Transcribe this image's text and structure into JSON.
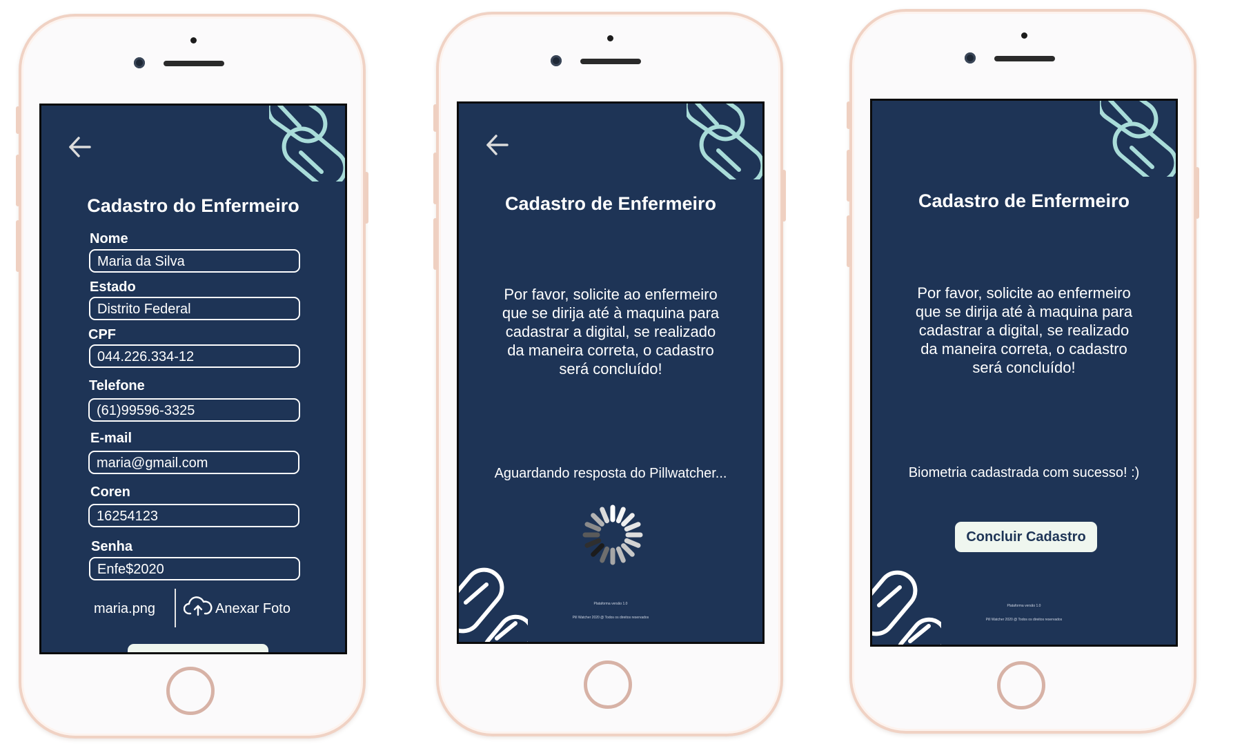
{
  "colors": {
    "screen_bg": "#1e3456",
    "accent_line": "#a9dcd9",
    "button_bg": "#eff6ef",
    "phone_frame": "#f0d2c4"
  },
  "phone1": {
    "back_icon": "arrow-left-icon",
    "title": "Cadastro do Enfermeiro",
    "fields": [
      {
        "label": "Nome",
        "value": "Maria da Silva"
      },
      {
        "label": "Estado",
        "value": "Distrito Federal"
      },
      {
        "label": "CPF",
        "value": "044.226.334-12"
      },
      {
        "label": "Telefone",
        "value": "(61)99596-3325"
      },
      {
        "label": "E-mail",
        "value": "maria@gmail.com"
      },
      {
        "label": "Coren",
        "value": "16254123"
      },
      {
        "label": "Senha",
        "value": "Enfe$2020"
      }
    ],
    "photo_filename": "maria.png",
    "attach_icon": "cloud-upload-icon",
    "attach_label": "Anexar Foto"
  },
  "phone2": {
    "back_icon": "arrow-left-icon",
    "title": "Cadastro de Enfermeiro",
    "message": [
      "Por favor, solicite ao enfermeiro",
      "que se dirija até à maquina para",
      "cadastrar a digital, se realizado",
      "da maneira correta, o cadastro",
      "será concluído!"
    ],
    "status": "Aguardando resposta do Pillwatcher...",
    "spinner_icon": "loading-spinner-icon",
    "footer_version": "Plataforma versão 1.0",
    "footer_rights": "Pill Watcher 2020 @ Todos os direitos reservados"
  },
  "phone3": {
    "title": "Cadastro de Enfermeiro",
    "message": [
      "Por favor, solicite ao enfermeiro",
      "que se dirija até à maquina para",
      "cadastrar a digital, se realizado",
      "da maneira correta, o cadastro",
      "será concluído!"
    ],
    "status": "Biometria cadastrada com sucesso! :)",
    "button_label": "Concluir Cadastro",
    "footer_version": "Plataforma versão 1.0",
    "footer_rights": "Pill Watcher 2020 @ Todos os direitos reservados"
  }
}
